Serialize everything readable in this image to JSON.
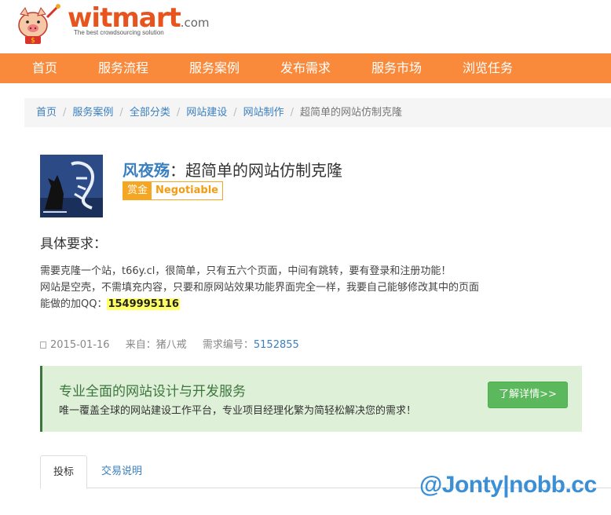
{
  "header": {
    "logo_text": "witmart",
    "logo_suffix": ".com",
    "tagline": "The best crowdsourcing solution"
  },
  "nav": {
    "items": [
      {
        "label": "首页"
      },
      {
        "label": "服务流程"
      },
      {
        "label": "服务案例"
      },
      {
        "label": "发布需求"
      },
      {
        "label": "服务市场"
      },
      {
        "label": "浏览任务"
      }
    ]
  },
  "breadcrumb": {
    "items": [
      "首页",
      "服务案例",
      "全部分类",
      "网站建设",
      "网站制作"
    ],
    "current": "超简单的网站仿制克隆"
  },
  "task": {
    "user": "风夜殇",
    "title": "：超简单的网站仿制克隆",
    "bounty_label": "赏金",
    "bounty_value": "Negotiable",
    "requirements_title": "具体要求：",
    "lines": [
      "需要克隆一个站，t66y.cl，很简单，只有五六个页面，中间有跳转，要有登录和注册功能！",
      "网站是空壳，不需填充内容，只要和原网站效果功能界面完全一样，我要自己能够修改其中的页面",
      "能做的加QQ："
    ],
    "qq": "1549995116",
    "date": "2015-01-16",
    "source": "来自：猪八戒",
    "id_label": "需求编号：",
    "id_value": "5152855"
  },
  "promo": {
    "title": "专业全面的网站设计与开发服务",
    "desc": "唯一覆盖全球的网站建设工作平台，专业项目经理化繁为简轻松解决您的需求！",
    "button": "了解详情>>"
  },
  "tabs": {
    "items": [
      {
        "label": "投标"
      },
      {
        "label": "交易说明"
      }
    ]
  },
  "watermark": "@Jonty|nobb.cc"
}
